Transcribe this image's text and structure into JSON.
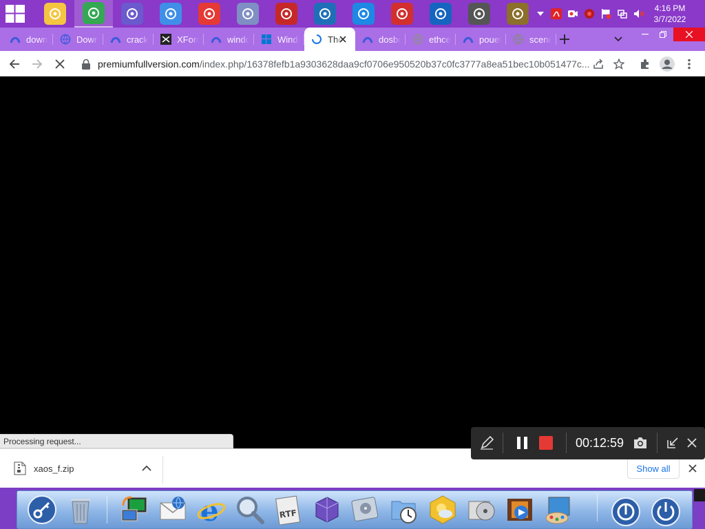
{
  "taskbar": {
    "pinned": [
      {
        "name": "file-explorer-icon",
        "color": "#f5c542"
      },
      {
        "name": "chrome-icon",
        "color": "#34a853"
      },
      {
        "name": "settings-icon",
        "color": "#6a5acd"
      },
      {
        "name": "control-panel-icon",
        "color": "#3f8fe8"
      },
      {
        "name": "vpn-shield-icon",
        "color": "#e53935"
      },
      {
        "name": "security-check-icon",
        "color": "#7f8fc4"
      },
      {
        "name": "antivirus-icon",
        "color": "#c62828"
      },
      {
        "name": "shield-lock-icon",
        "color": "#1f6fb8"
      },
      {
        "name": "ccleaner-icon",
        "color": "#1e88e5"
      },
      {
        "name": "screen-recorder-icon",
        "color": "#d32f2f"
      },
      {
        "name": "malwarebytes-icon",
        "color": "#1565c0"
      },
      {
        "name": "install-disk-icon",
        "color": "#555555"
      },
      {
        "name": "dosbox-icon",
        "color": "#8b6f2a"
      }
    ],
    "clock": {
      "time": "4:16 PM",
      "date": "3/7/2022"
    }
  },
  "browser": {
    "tabs": [
      {
        "title": "downloads",
        "favicon": "arc-favicon",
        "color": "#3b5bdb"
      },
      {
        "title": "Download",
        "favicon": "globe-favicon",
        "color": "#3b5bdb"
      },
      {
        "title": "crack",
        "favicon": "arc-favicon",
        "color": "#3b5bdb"
      },
      {
        "title": "XForce",
        "favicon": "xforce-favicon",
        "color": "#222222"
      },
      {
        "title": "windows",
        "favicon": "arc-favicon",
        "color": "#3b5bdb"
      },
      {
        "title": "Windows",
        "favicon": "windows-favicon",
        "color": "#0078d4"
      },
      {
        "title": "The",
        "favicon": "loading-spinner",
        "color": "#1a73e8",
        "active": true
      },
      {
        "title": "dosbox",
        "favicon": "arc-favicon",
        "color": "#3b5bdb"
      },
      {
        "title": "ethcean",
        "favicon": "ethcean-favicon",
        "color": "#8e8e8e"
      },
      {
        "title": "pouet",
        "favicon": "arc-favicon",
        "color": "#3b5bdb"
      },
      {
        "title": "scene",
        "favicon": "globe-favicon",
        "color": "#888888"
      }
    ],
    "url_host": "premiumfullversion.com",
    "url_path": "/index.php/16378fefb1a9303628daa9cf0706e950520b37c0fc3777a8ea51bec10b051477c...",
    "status": "Processing request...",
    "download": {
      "filename": "xaos_f.zip"
    },
    "show_all_label": "Show all"
  },
  "recorder": {
    "elapsed": "00:12:59"
  }
}
